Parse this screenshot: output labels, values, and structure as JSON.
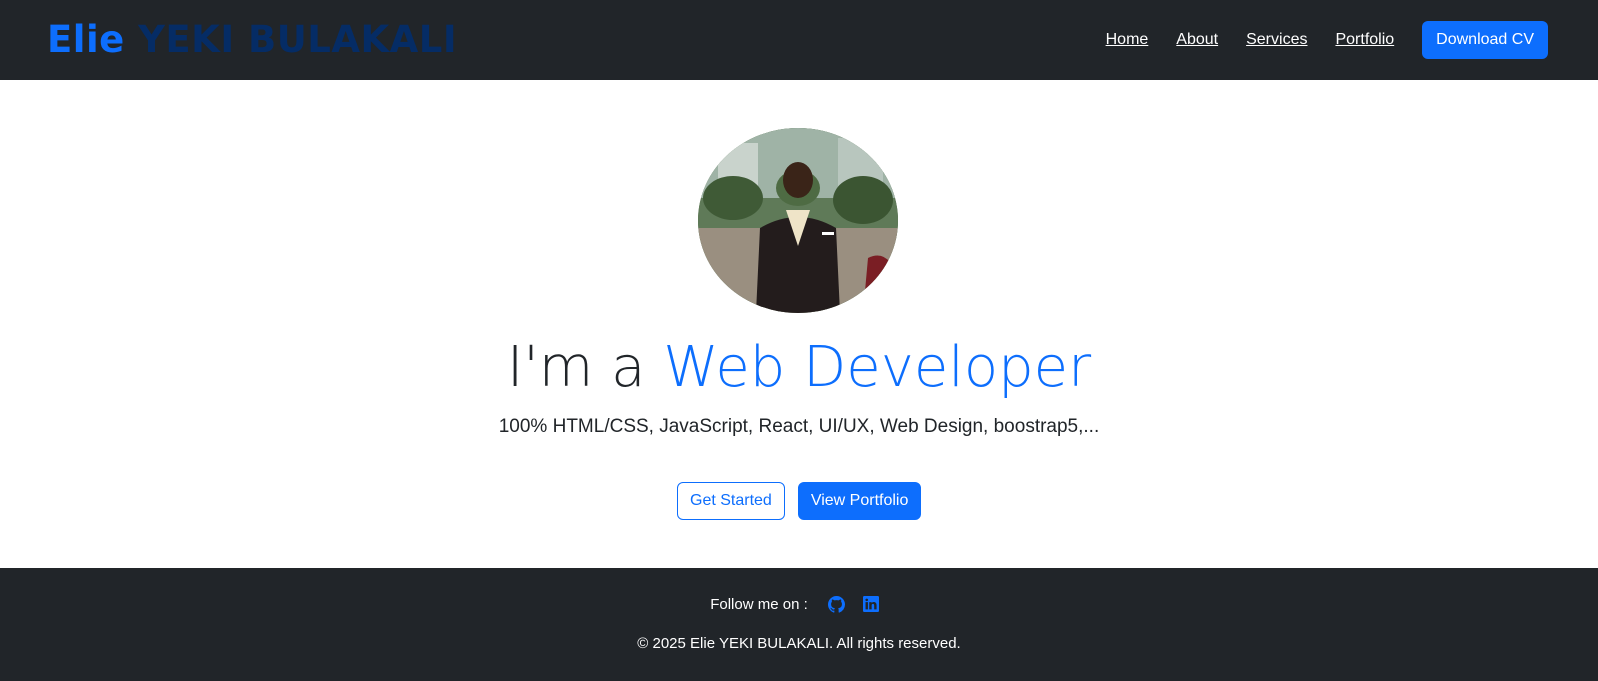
{
  "brand": {
    "first": "Elie",
    "last": " YEKI BULAKALI"
  },
  "nav": {
    "items": [
      {
        "label": "Home"
      },
      {
        "label": "About"
      },
      {
        "label": "Services"
      },
      {
        "label": "Portfolio"
      }
    ],
    "cv_button": "Download CV"
  },
  "hero": {
    "headline_prefix": "I'm a ",
    "headline_accent": "Web Developer",
    "subline": "100% HTML/CSS, JavaScript, React, UI/UX, Web Design, boostrap5,...",
    "get_started": "Get Started",
    "view_portfolio": "View Portfolio"
  },
  "footer": {
    "follow_label": "Follow me on :",
    "social_icons": [
      "github-icon",
      "linkedin-icon"
    ],
    "copyright": "© 2025 Elie YEKI BULAKALI. All rights reserved."
  },
  "colors": {
    "primary": "#0d6efd",
    "dark": "#212529",
    "brand_dark": "#052c65"
  }
}
